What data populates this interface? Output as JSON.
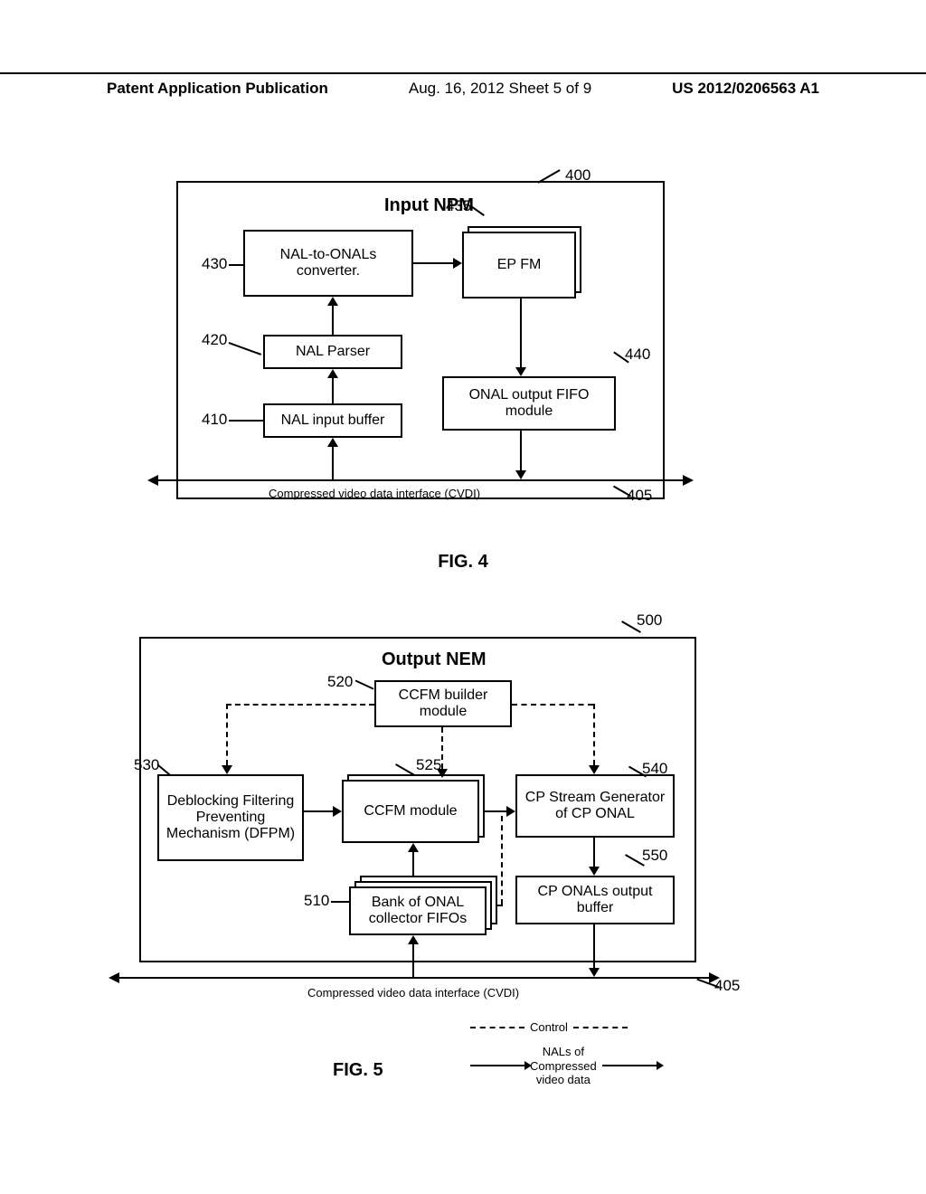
{
  "header": {
    "left": "Patent Application Publication",
    "center": "Aug. 16, 2012  Sheet 5 of 9",
    "right": "US 2012/0206563 A1"
  },
  "fig4": {
    "title": "Input NPM",
    "caption": "FIG. 4",
    "ref400": "400",
    "ref405": "405",
    "ref410": "410",
    "ref420": "420",
    "ref430": "430",
    "ref435": "435",
    "ref440": "440",
    "box430": "NAL-to-ONALs converter.",
    "box435": "EP FM",
    "box420": "NAL Parser",
    "box410": "NAL input buffer",
    "box440": "ONAL output FIFO module",
    "cvdi": "Compressed video data interface (CVDI)"
  },
  "fig5": {
    "title": "Output NEM",
    "caption": "FIG. 5",
    "ref500": "500",
    "ref405": "405",
    "ref510": "510",
    "ref520": "520",
    "ref525": "525",
    "ref530": "530",
    "ref540": "540",
    "ref550": "550",
    "box520": "CCFM builder module",
    "box530": "Deblocking Filtering Preventing Mechanism (DFPM)",
    "box525": "CCFM module",
    "box540": "CP Stream Generator of CP ONAL",
    "box510": "Bank of ONAL collector FIFOs",
    "box550": "CP ONALs output buffer",
    "cvdi": "Compressed video data interface (CVDI)"
  },
  "legend": {
    "control": "Control",
    "nals_line1": "NALs of",
    "nals_line2": "Compressed",
    "nals_line3": "video data"
  }
}
